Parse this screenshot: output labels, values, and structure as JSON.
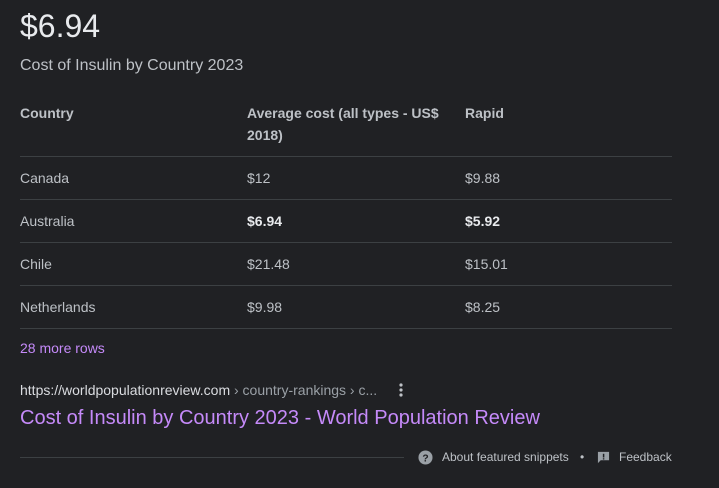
{
  "answer": "$6.94",
  "subtitle": "Cost of Insulin by Country 2023",
  "table": {
    "headers": [
      "Country",
      "Average cost (all types - US$ 2018)",
      "Rapid"
    ],
    "rows": [
      {
        "country": "Canada",
        "average": "$12",
        "rapid": "$9.88",
        "highlight": false
      },
      {
        "country": "Australia",
        "average": "$6.94",
        "rapid": "$5.92",
        "highlight": true
      },
      {
        "country": "Chile",
        "average": "$21.48",
        "rapid": "$15.01",
        "highlight": false
      },
      {
        "country": "Netherlands",
        "average": "$9.98",
        "rapid": "$8.25",
        "highlight": false
      }
    ]
  },
  "more_rows": "28 more rows",
  "source": {
    "domain": "https://worldpopulationreview.com",
    "path": " › country-rankings › c...",
    "title": "Cost of Insulin by Country 2023 - World Population Review"
  },
  "footer": {
    "about": "About featured snippets",
    "separator": "•",
    "feedback": "Feedback"
  },
  "icons": {
    "kebab": "more-vert-icon",
    "about": "help-circle-icon",
    "feedback": "feedback-icon"
  },
  "colors": {
    "background": "#202124",
    "link_visited": "#c58af9",
    "text": "#bdc1c6",
    "divider": "#3c4043"
  }
}
